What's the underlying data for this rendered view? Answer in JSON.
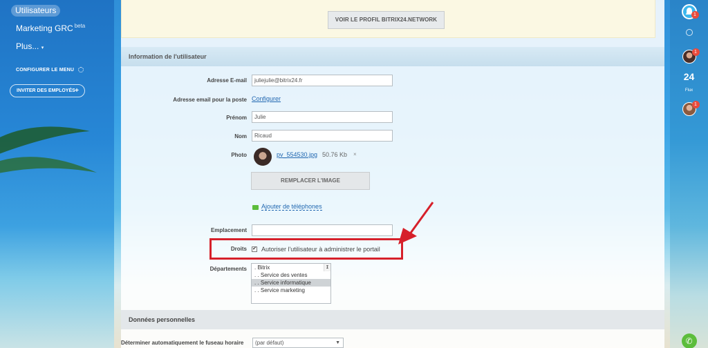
{
  "sidebar": {
    "active_item": "Utilisateurs",
    "items": [
      {
        "label": "Marketing GRC",
        "suffix": "beta"
      },
      {
        "label": "Plus...",
        "suffix": "▾"
      }
    ],
    "configure_menu": "CONFIGURER LE MENU",
    "invite_employees": "INVITER DES EMPLOYÉS",
    "invite_icon": "+"
  },
  "rail": {
    "notifications_badge": "1",
    "avatar_badge": "1",
    "calendar_number": "24",
    "calendar_label": "Flux",
    "group_badge": "1",
    "phone_icon": "✆"
  },
  "top_box": {
    "button_label": "VOIR LE PROFIL BITRIX24.NETWORK"
  },
  "user_info": {
    "section_title": "Information de l'utilisateur",
    "email_label": "Adresse E-mail",
    "email_value": "juliejulie@bitrix24.fr",
    "post_email_label": "Adresse email pour la poste",
    "post_email_link": "Configurer",
    "first_name_label": "Prénom",
    "first_name_value": "Julie",
    "last_name_label": "Nom",
    "last_name_value": "Ricaud",
    "photo_label": "Photo",
    "photo_file": "pv_554530.jpg",
    "photo_size": "50.76 Kb",
    "photo_remove": "×",
    "replace_image": "REMPLACER L'IMAGE",
    "add_phones": "Ajouter de téléphones",
    "location_label": "Emplacement",
    "location_value": "",
    "rights_label": "Droits",
    "rights_checked": "✔",
    "rights_text": "Autoriser l'utilisateur à administrer le portail",
    "departments_label": "Départements",
    "departments": [
      ". Bitrix",
      ". . Service des ventes",
      ". . Service informatique",
      ". . Service marketing"
    ],
    "selected_department_index": 2
  },
  "personal": {
    "section_title": "Données personnelles",
    "timezone_label": "Déterminer automatiquement le fuseau horaire",
    "timezone_value": "(par défaut)"
  },
  "colors": {
    "highlight_red": "#d6202a",
    "link_blue": "#2067b0",
    "section_blue": "#d8eaf5"
  }
}
